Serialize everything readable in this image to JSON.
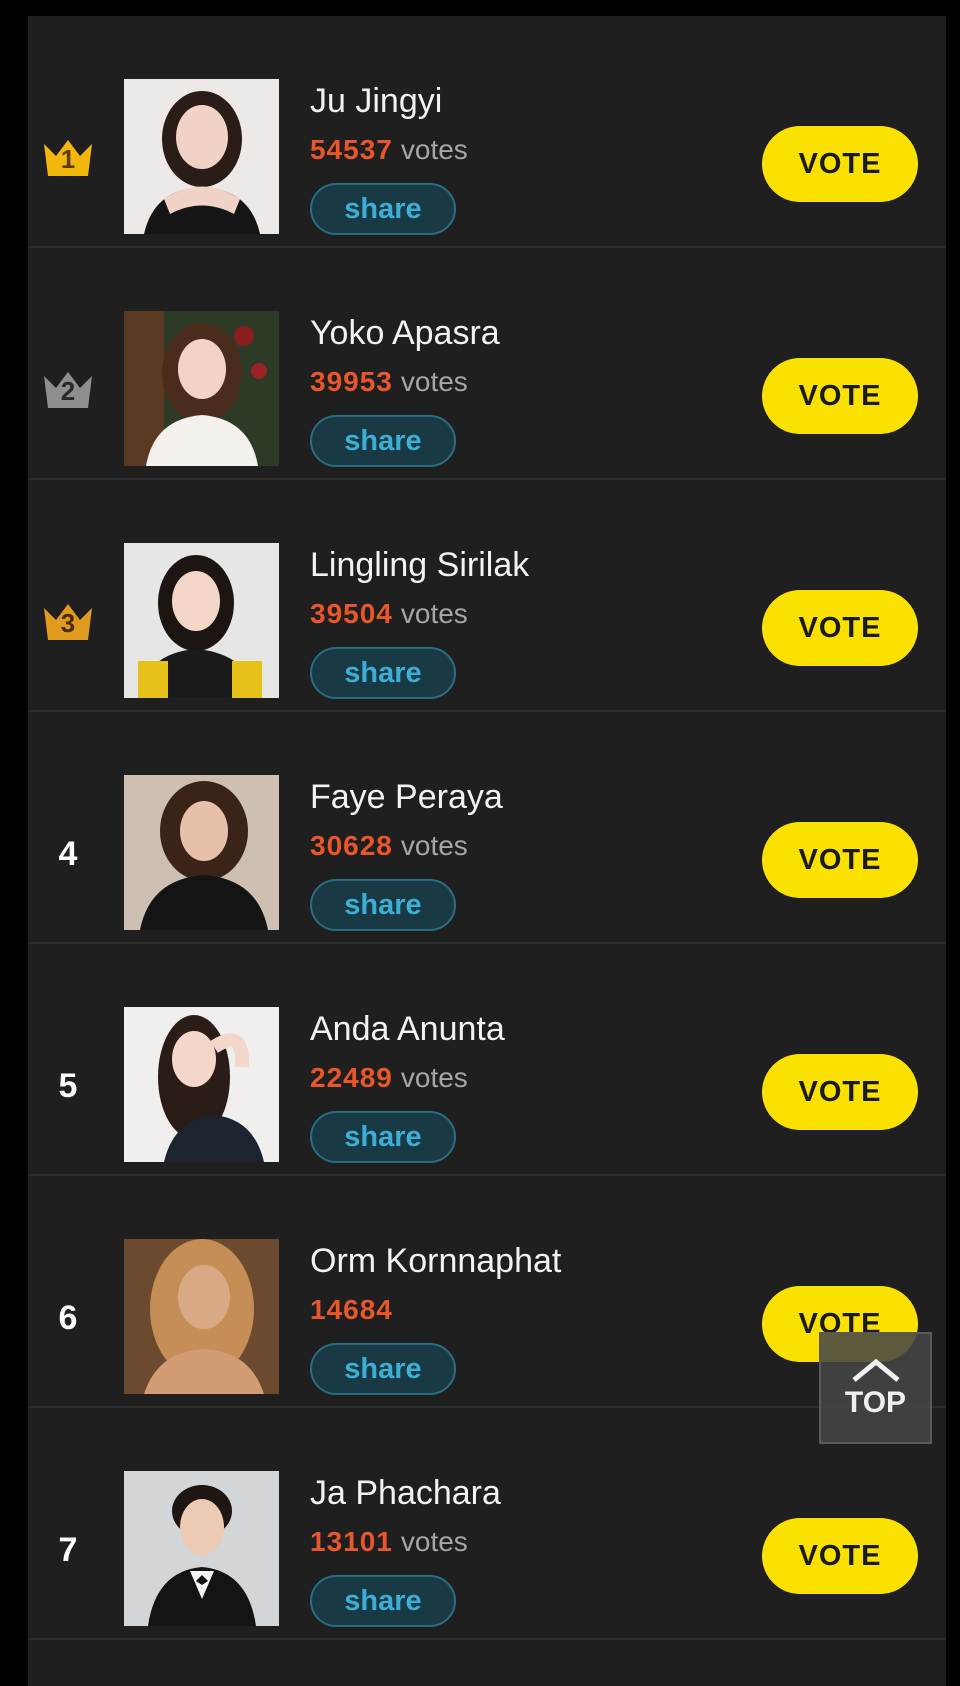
{
  "vote_button_label": "VOTE",
  "share_button_label": "share",
  "votes_unit": "votes",
  "top_button_label": "TOP",
  "colors": {
    "vote_button": "#fbe100",
    "vote_count": "#e8562a",
    "share_text": "#3bb0d6",
    "crown_gold": "#f2b80c",
    "crown_silver": "#8e8e8e",
    "crown_bronze": "#e09a1e"
  },
  "entries": [
    {
      "rank": "1",
      "name": "Ju Jingyi",
      "votes": "54537",
      "unit": "votes",
      "badge": "crown-gold-icon"
    },
    {
      "rank": "2",
      "name": "Yoko Apasra",
      "votes": "39953",
      "unit": "votes",
      "badge": "crown-silver-icon"
    },
    {
      "rank": "3",
      "name": "Lingling Sirilak",
      "votes": "39504",
      "unit": "votes",
      "badge": "crown-bronze-icon"
    },
    {
      "rank": "4",
      "name": "Faye Peraya",
      "votes": "30628",
      "unit": "votes",
      "badge": ""
    },
    {
      "rank": "5",
      "name": "Anda Anunta",
      "votes": "22489",
      "unit": "votes",
      "badge": ""
    },
    {
      "rank": "6",
      "name": "Orm Kornnaphat",
      "votes": "14684",
      "unit": "",
      "badge": ""
    },
    {
      "rank": "7",
      "name": "Ja Phachara",
      "votes": "13101",
      "unit": "votes",
      "badge": ""
    }
  ]
}
